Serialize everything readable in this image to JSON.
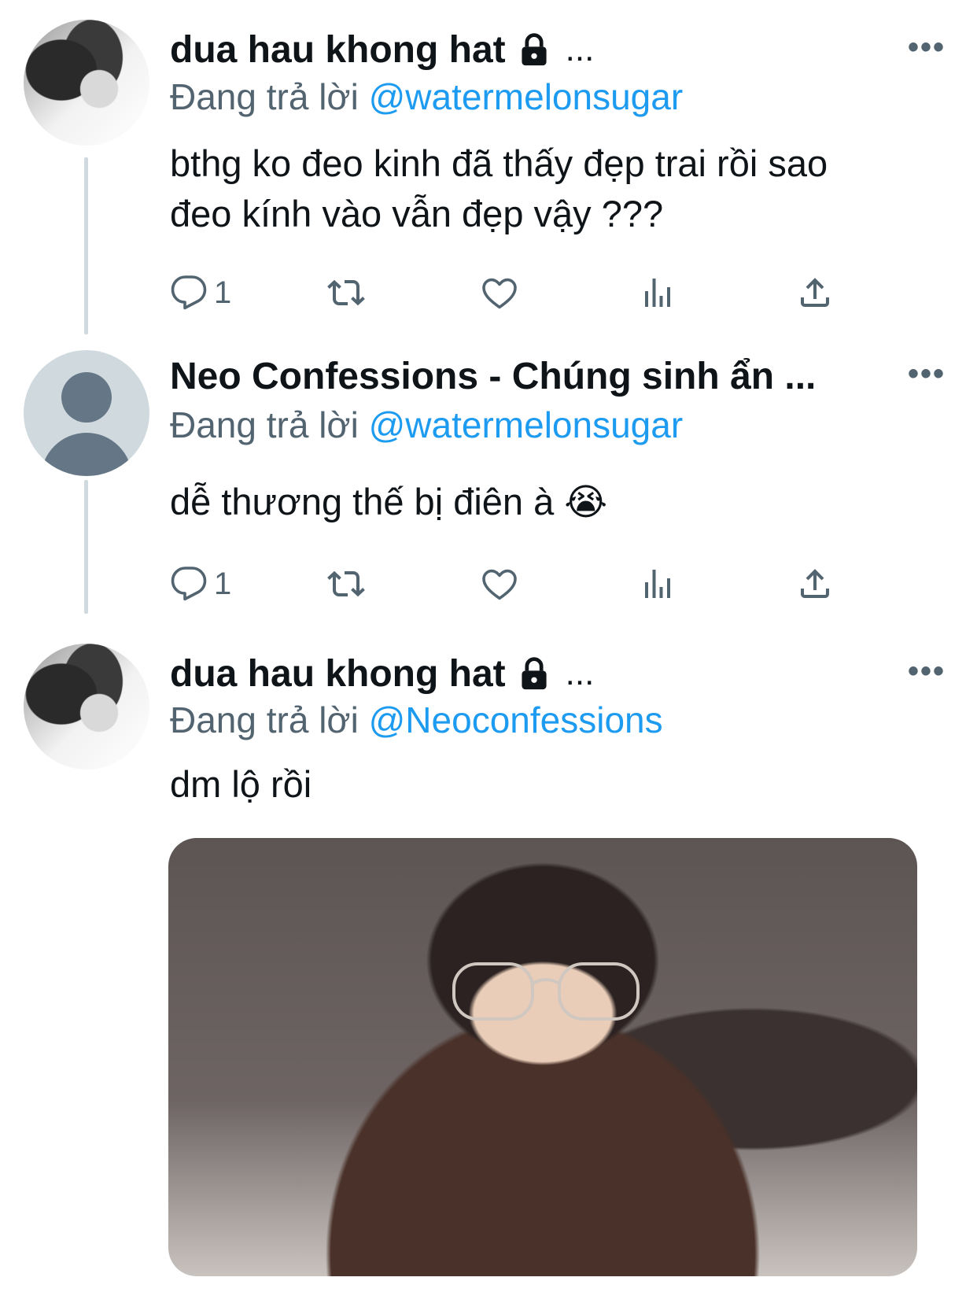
{
  "tweets": [
    {
      "name": "dua hau khong hat",
      "name_suffix": "...",
      "reply_prefix": "Đang trả lời",
      "reply_handle": "@watermelonsugar",
      "text_lines": [
        "bthg ko đeo kinh đã thấy đẹp trai rồi sao",
        "đeo kính vào vẫn đẹp vậy ???"
      ],
      "reply_count": "1",
      "more": "•••"
    },
    {
      "name": "Neo Confessions - Chúng sinh ẩn ...",
      "reply_prefix": "Đang trả lời",
      "reply_handle": "@watermelonsugar",
      "text_lines": [
        "dễ thương thế bị điên à 😭"
      ],
      "reply_count": "1",
      "more": "•••"
    },
    {
      "name": "dua hau khong hat",
      "name_suffix": "...",
      "reply_prefix": "Đang trả lời",
      "reply_handle": "@Neoconfessions",
      "text_lines": [
        "dm lộ rồi"
      ],
      "more": "•••"
    }
  ],
  "icons": {
    "reply": "reply-icon",
    "retweet": "retweet-icon",
    "like": "heart-icon",
    "views": "views-icon",
    "share": "share-icon",
    "lock": "lock-icon"
  },
  "colors": {
    "link": "#1d9bf0",
    "secondary": "#536471",
    "thread_line": "#cfd9de"
  }
}
